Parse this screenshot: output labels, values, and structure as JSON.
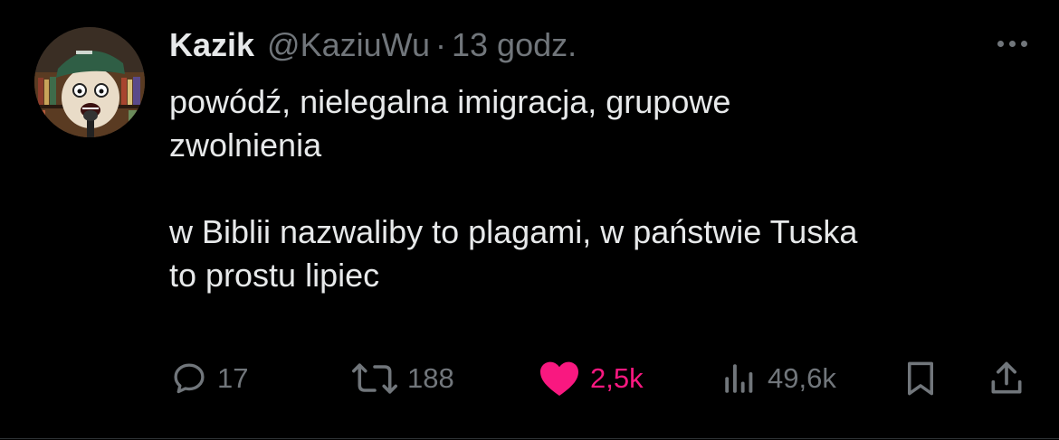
{
  "tweet": {
    "author": {
      "display_name": "Kazik",
      "handle": "@KaziuWu",
      "separator": "·",
      "time": "13 godz."
    },
    "text": {
      "line1": "powódź, nielegalna imigracja, grupowe",
      "line2": "zwolnienia",
      "line3": "w Biblii nazwaliby to plagami, w państwie Tuska",
      "line4": "to prostu lipiec"
    },
    "actions": {
      "replies": "17",
      "reposts": "188",
      "likes": "2,5k",
      "views": "49,6k"
    },
    "icons": {
      "more": "more-horizontal-icon",
      "reply": "reply-bubble-icon",
      "repost": "repost-icon",
      "like": "heart-filled-icon",
      "views": "views-bar-chart-icon",
      "bookmark": "bookmark-icon",
      "share": "share-upload-icon"
    },
    "colors": {
      "background": "#000000",
      "text_primary": "#e7e9ea",
      "text_secondary": "#71767b",
      "like_active": "#f91880"
    }
  }
}
